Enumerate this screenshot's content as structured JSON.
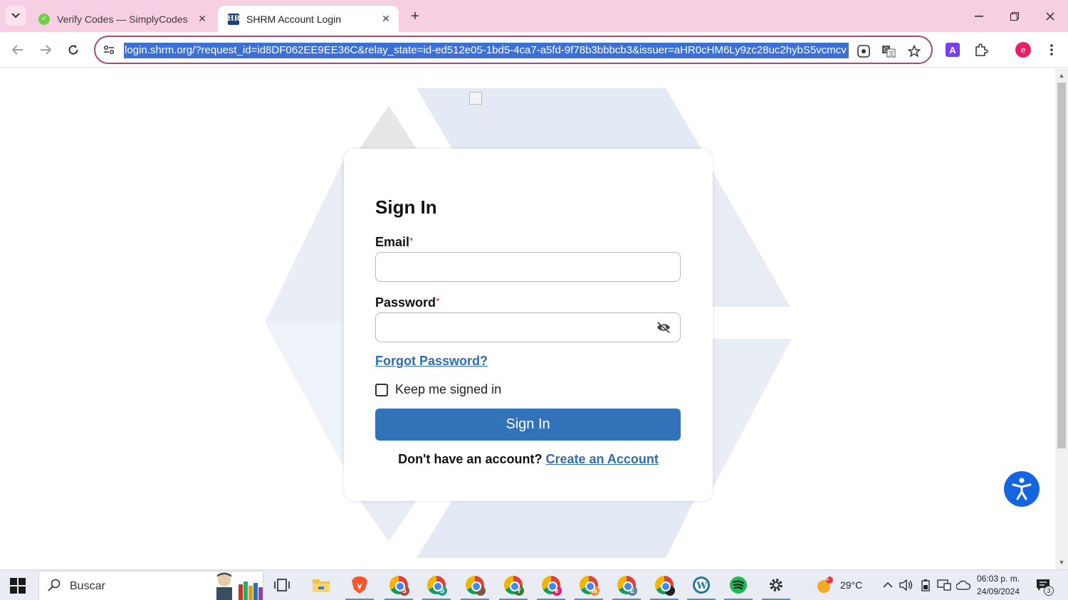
{
  "browser": {
    "tabs": [
      {
        "title": "Verify Codes — SimplyCodes",
        "active": false,
        "favicon": "simplycodes-check-icon"
      },
      {
        "title": "SHRM Account Login",
        "active": true,
        "favicon": "shrm-hr-icon",
        "favicon_text": "HR"
      }
    ],
    "url": "login.shrm.org/?request_id=id8DF062EE9EE36C&relay_state=id-ed512e05-1bd5-4ca7-a5fd-9f78b3bbbcb3&issuer=aHR0cHM6Ly9zc28uc2hybS5vcmcv",
    "profile_initial": "e",
    "extension_letter": "A",
    "accent_color": "#a24b73"
  },
  "page": {
    "title": "Sign In",
    "email_label": "Email",
    "email_value": "",
    "password_label": "Password",
    "password_value": "",
    "required_mark": "*",
    "forgot_link": "Forgot Password?",
    "keep_signed_label": "Keep me signed in",
    "keep_signed_checked": false,
    "submit_label": "Sign In",
    "no_account_text": "Don't have an account?",
    "create_account_link": "Create an Account",
    "button_color": "#3272b8",
    "link_color": "#2f6db3"
  },
  "taskbar": {
    "search_placeholder": "Buscar",
    "pinned_apps": [
      "task-view-icon",
      "file-explorer-icon",
      "brave-icon",
      "chrome-profile-s-icon",
      "chrome-profile-s2-icon",
      "chrome-profile-photo-icon",
      "chrome-profile-y-icon",
      "chrome-profile-e-icon",
      "chrome-profile-ia-icon",
      "chrome-profile-e2-icon",
      "chrome-profile-dark-icon",
      "wordpress-icon",
      "spotify-icon",
      "settings-icon"
    ],
    "chrome_badges": [
      "S",
      "S",
      "",
      "Y",
      "e",
      "ia",
      "E",
      ""
    ],
    "weather_temp": "29°C",
    "weather_alert": "1",
    "time": "06:03 p. m.",
    "date": "24/09/2024",
    "notification_count": "3"
  }
}
